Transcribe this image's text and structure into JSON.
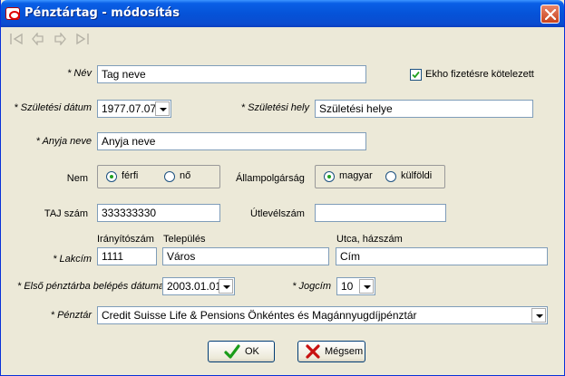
{
  "window": {
    "title": "Pénztártag - módosítás"
  },
  "icons": {
    "app": "app-icon",
    "close": "close-icon",
    "nav": [
      "first-icon",
      "prev-icon",
      "next-icon",
      "last-icon"
    ],
    "ok": "checkmark-icon",
    "cancel": "x-icon"
  },
  "form": {
    "nev": {
      "label": "* Név",
      "value": "Tag neve"
    },
    "ekho": {
      "label": "Ekho fizetésre kötelezett",
      "checked": true
    },
    "szul_datum": {
      "label": "* Születési dátum",
      "value": "1977.07.07"
    },
    "szul_hely": {
      "label": "* Születési hely",
      "value": "Születési helye"
    },
    "anyja": {
      "label": "* Anyja neve",
      "value": "Anyja neve"
    },
    "nem": {
      "label": "Nem",
      "options": [
        "férfi",
        "nő"
      ],
      "selected": "férfi"
    },
    "allampolgarsag": {
      "label": "Állampolgárság",
      "options": [
        "magyar",
        "külföldi"
      ],
      "selected": "magyar"
    },
    "taj": {
      "label": "TAJ szám",
      "value": "333333330"
    },
    "utlevel": {
      "label": "Útlevélszám",
      "value": ""
    },
    "lakcim": {
      "label": "* Lakcím",
      "irsz_header": "Irányítószám",
      "irsz": "1111",
      "telepules_header": "Település",
      "telepules": "Város",
      "utca_header": "Utca, házszám",
      "utca": "Cím"
    },
    "belepes": {
      "label": "* Első pénztárba belépés dátuma",
      "value": "2003.01.01"
    },
    "jogcim": {
      "label": "* Jogcím",
      "value": "10"
    },
    "penztar": {
      "label": "* Pénztár",
      "value": "Credit Suisse Life & Pensions Önkéntes és Magánnyugdíjpénztár"
    }
  },
  "buttons": {
    "ok": "OK",
    "cancel": "Mégsem"
  },
  "colors": {
    "titlebar": "#0553d8",
    "close": "#c9431d",
    "window_bg": "#ece9d8",
    "field_border": "#7f9db9",
    "radio_dot": "#21a121",
    "ok_check": "#1a9c1a",
    "cancel_x": "#c81010"
  }
}
